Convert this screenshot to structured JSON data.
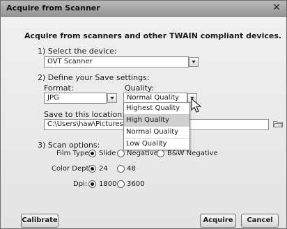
{
  "window": {
    "title": "Acquire from Scanner",
    "close_glyph": "✕"
  },
  "header": {
    "text": "Acquire from scanners and other TWAIN compliant devices."
  },
  "device": {
    "section_label": "1) Select the device:",
    "value": "OVT Scanner"
  },
  "save": {
    "section_label": "2) Define your Save settings:",
    "format_label": "Format:",
    "format_value": "JPG",
    "quality_label": "Quality:",
    "quality_value": "Normal Quality",
    "quality_options": [
      "Highest Quality",
      "High Quality",
      "Normal Quality",
      "Low Quality"
    ],
    "highlighted_option": "High Quality",
    "location_label": "Save to this location:",
    "location_value": "C:\\Users\\haw\\Pictures\\"
  },
  "scan": {
    "section_label": "3) Scan options:",
    "film_type_label": "Film Type:",
    "film_options": [
      "Slide",
      "Negative",
      "B&W Negative"
    ],
    "film_selected": "Slide",
    "color_depth_label": "Color Depth:",
    "color_depth_options": [
      "24",
      "48"
    ],
    "color_depth_selected": "24",
    "dpi_label": "Dpi:",
    "dpi_options": [
      "1800",
      "3600"
    ],
    "dpi_selected": "1800"
  },
  "buttons": {
    "calibrate": "Calibrate",
    "acquire": "Acquire",
    "cancel": "Cancel"
  },
  "colors": {
    "titlebar": "#a8a8a8",
    "dialog_bg": "#ececec",
    "highlight": "#cfcfcf"
  },
  "icons": {
    "folder": "folder-icon",
    "close": "close-icon",
    "dropdown": "chevron-down-icon",
    "cursor": "mouse-pointer-icon"
  }
}
